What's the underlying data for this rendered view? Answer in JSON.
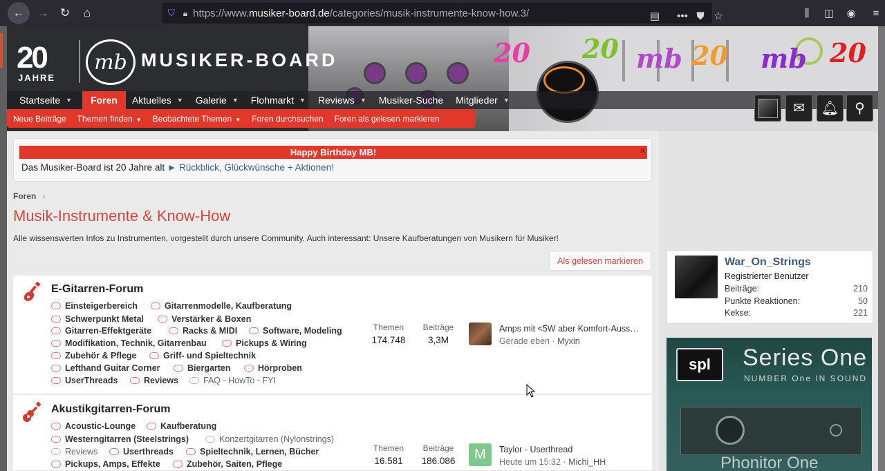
{
  "browser": {
    "url_prefix": "https://www.",
    "url_host": "musiker-board.de",
    "url_path": "/categories/musik-instrumente-know-how.3/"
  },
  "header": {
    "logo_years": "20",
    "logo_jahre": "JAHRE",
    "logo_mb": "mb",
    "logo_text": "MUSIKER-BOARD"
  },
  "nav": {
    "items": [
      {
        "label": "Startseite",
        "has_dropdown": true
      },
      {
        "label": "Foren",
        "has_dropdown": false,
        "active": true
      },
      {
        "label": "Aktuelles",
        "has_dropdown": true
      },
      {
        "label": "Galerie",
        "has_dropdown": true
      },
      {
        "label": "Flohmarkt",
        "has_dropdown": true
      },
      {
        "label": "Reviews",
        "has_dropdown": true
      },
      {
        "label": "Musiker-Suche",
        "has_dropdown": false
      },
      {
        "label": "Mitglieder",
        "has_dropdown": true
      }
    ]
  },
  "subnav": {
    "items": [
      {
        "label": "Neue Beiträge",
        "has_dropdown": false
      },
      {
        "label": "Themen finden",
        "has_dropdown": true
      },
      {
        "label": "Beobachtete Themen",
        "has_dropdown": true
      },
      {
        "label": "Foren durchsuchen",
        "has_dropdown": false
      },
      {
        "label": "Foren als gelesen markieren",
        "has_dropdown": false
      }
    ]
  },
  "notice": {
    "title": "Happy Birthday MB!",
    "close": "×",
    "text": "Das Musiker-Board ist 20 Jahre alt ",
    "arrow": "►",
    "link": " Rückblick, Glückwünsche + Aktionen!"
  },
  "breadcrumb": {
    "label": "Foren",
    "separator": "›"
  },
  "page": {
    "title": "Musik-Instrumente & Know-How",
    "description": "Alle wissenswerten Infos zu Instrumenten, vorgestellt durch unsere Community. Auch interessant: Unsere Kaufberatungen von Musikern für Musiker!",
    "mark_read": "Als gelesen markieren"
  },
  "forums": [
    {
      "title": "E-Gitarren-Forum",
      "subforums": [
        {
          "label": "Einsteigerbereich"
        },
        {
          "label": "Gitarrenmodelle, Kaufberatung"
        },
        {
          "label": "Schwerpunkt Metal"
        },
        {
          "label": "Verstärker & Boxen"
        },
        {
          "label": "Gitarren-Effektgeräte"
        },
        {
          "label": "Racks & MIDI"
        },
        {
          "label": "Software, Modeling"
        },
        {
          "label": "Modifikation, Technik, Gitarrenbau"
        },
        {
          "label": "Pickups & Wiring"
        },
        {
          "label": "Zubehör & Pflege"
        },
        {
          "label": "Griff- und Spieltechnik"
        },
        {
          "label": "Lefthand Guitar Corner"
        },
        {
          "label": "Biergarten"
        },
        {
          "label": "Hörproben"
        },
        {
          "label": "UserThreads"
        },
        {
          "label": "Reviews"
        },
        {
          "label": "FAQ - HowTo - FYI",
          "read": true
        }
      ],
      "themen_label": "Themen",
      "themen": "174.748",
      "beitraege_label": "Beiträge",
      "beitraege": "3,3M",
      "last_title": "Amps mit <5W aber Komfort-Auss…",
      "last_time": "Gerade eben",
      "last_sep": " · ",
      "last_user": "Myxin"
    },
    {
      "title": "Akustikgitarren-Forum",
      "subforums": [
        {
          "label": "Acoustic-Lounge"
        },
        {
          "label": "Kaufberatung"
        },
        {
          "label": "Westerngitarren (Steelstrings)"
        },
        {
          "label": "Konzertgitarren (Nylonstrings)",
          "read": true
        },
        {
          "label": "Reviews",
          "read": true
        },
        {
          "label": "Userthreads"
        },
        {
          "label": "Spieltechnik, Lernen, Bücher"
        },
        {
          "label": "Pickups, Amps, Effekte"
        },
        {
          "label": "Zubehör, Saiten, Pflege"
        }
      ],
      "themen_label": "Themen",
      "themen": "16.581",
      "beitraege_label": "Beiträge",
      "beitraege": "186.086",
      "avatar_letter": "M",
      "last_title": "Taylor - Userthread",
      "last_time": "Heute um 15:32",
      "last_sep": " · ",
      "last_user": "Michi_HH"
    }
  ],
  "sidebar": {
    "user": {
      "name": "War_On_Strings",
      "role": "Registrierter Benutzer",
      "stats": [
        {
          "label": "Beiträge:",
          "value": "210"
        },
        {
          "label": "Punkte Reaktionen:",
          "value": "50"
        },
        {
          "label": "Kekse:",
          "value": "221"
        }
      ]
    },
    "ad": {
      "logo": "spl",
      "title": "Series One",
      "subtitle": "NUMBER One IN SOUND",
      "footer": "Phonitor One"
    }
  },
  "colors": {
    "brand_red": "#e2372b",
    "title_red": "#d9473b",
    "link_blue": "#3d5a80"
  }
}
